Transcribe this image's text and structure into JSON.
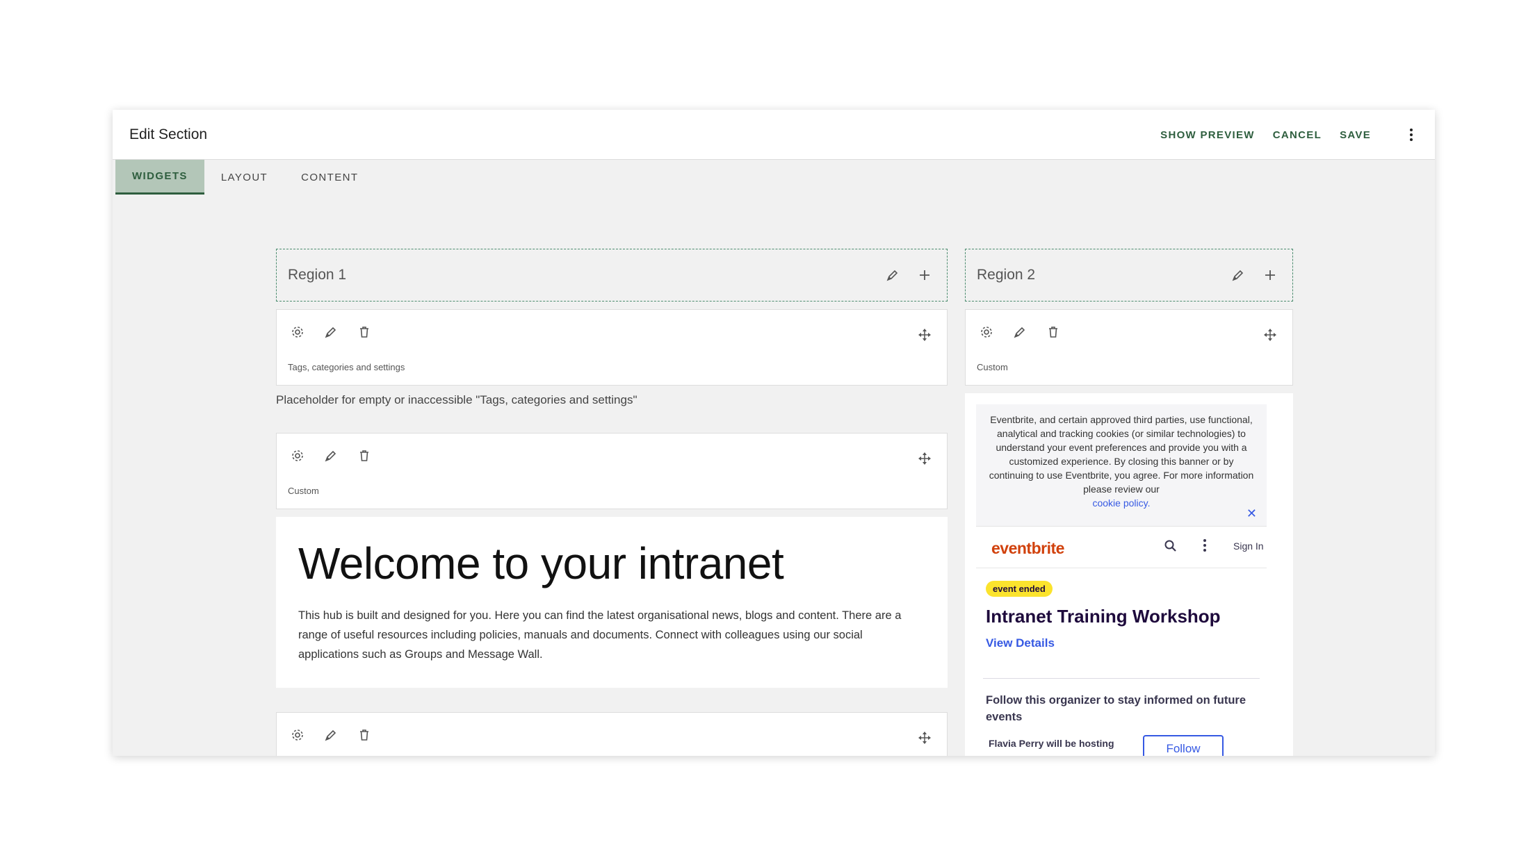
{
  "header": {
    "title": "Edit Section",
    "actions": [
      "SHOW PREVIEW",
      "CANCEL",
      "SAVE"
    ],
    "more_icon": "more-vertical-icon"
  },
  "tabs": [
    {
      "label": "WIDGETS",
      "active": true
    },
    {
      "label": "LAYOUT",
      "active": false
    },
    {
      "label": "CONTENT",
      "active": false
    }
  ],
  "colors": {
    "accent": "#2e5e3e",
    "active_tab_bg": "#b3c6b8",
    "region_border": "#4b8c6e",
    "eventbrite_brand": "#d1410c",
    "eventbrite_link": "#3659e3",
    "badge_yellow": "#fbe32d"
  },
  "regions": [
    {
      "title": "Region 1",
      "widgets": [
        {
          "label": "Tags, categories and settings",
          "placeholder": "Placeholder for empty or inaccessible \"Tags, categories and settings\""
        },
        {
          "label": "Custom"
        }
      ],
      "welcome": {
        "heading": "Welcome to your intranet",
        "body": "This hub is built and designed for you. Here you can find the latest organisational news, blogs and content. There are a range of useful resources including policies, manuals and documents. Connect with colleagues using our social applications such as Groups and Message Wall."
      }
    },
    {
      "title": "Region 2",
      "widgets": [
        {
          "label": "Custom"
        }
      ],
      "eventbrite": {
        "cookie_text": "Eventbrite, and certain approved third parties, use functional, analytical and tracking cookies (or similar technologies) to understand your event preferences and provide you with a customized experience. By closing this banner or by continuing to use Eventbrite, you agree. For more information please review our",
        "cookie_link": "cookie policy.",
        "logo": "eventbrite",
        "sign_in": "Sign In",
        "badge": "event ended",
        "event_title": "Intranet Training Workshop",
        "view_details": "View Details",
        "follow_text": "Follow this organizer to stay informed on future events",
        "host_text": "Flavia Perry will be hosting",
        "follow_button": "Follow"
      }
    }
  ],
  "icons": [
    "settings-icon",
    "edit-icon",
    "delete-icon",
    "move-icon",
    "add-icon",
    "search-icon",
    "close-icon"
  ]
}
